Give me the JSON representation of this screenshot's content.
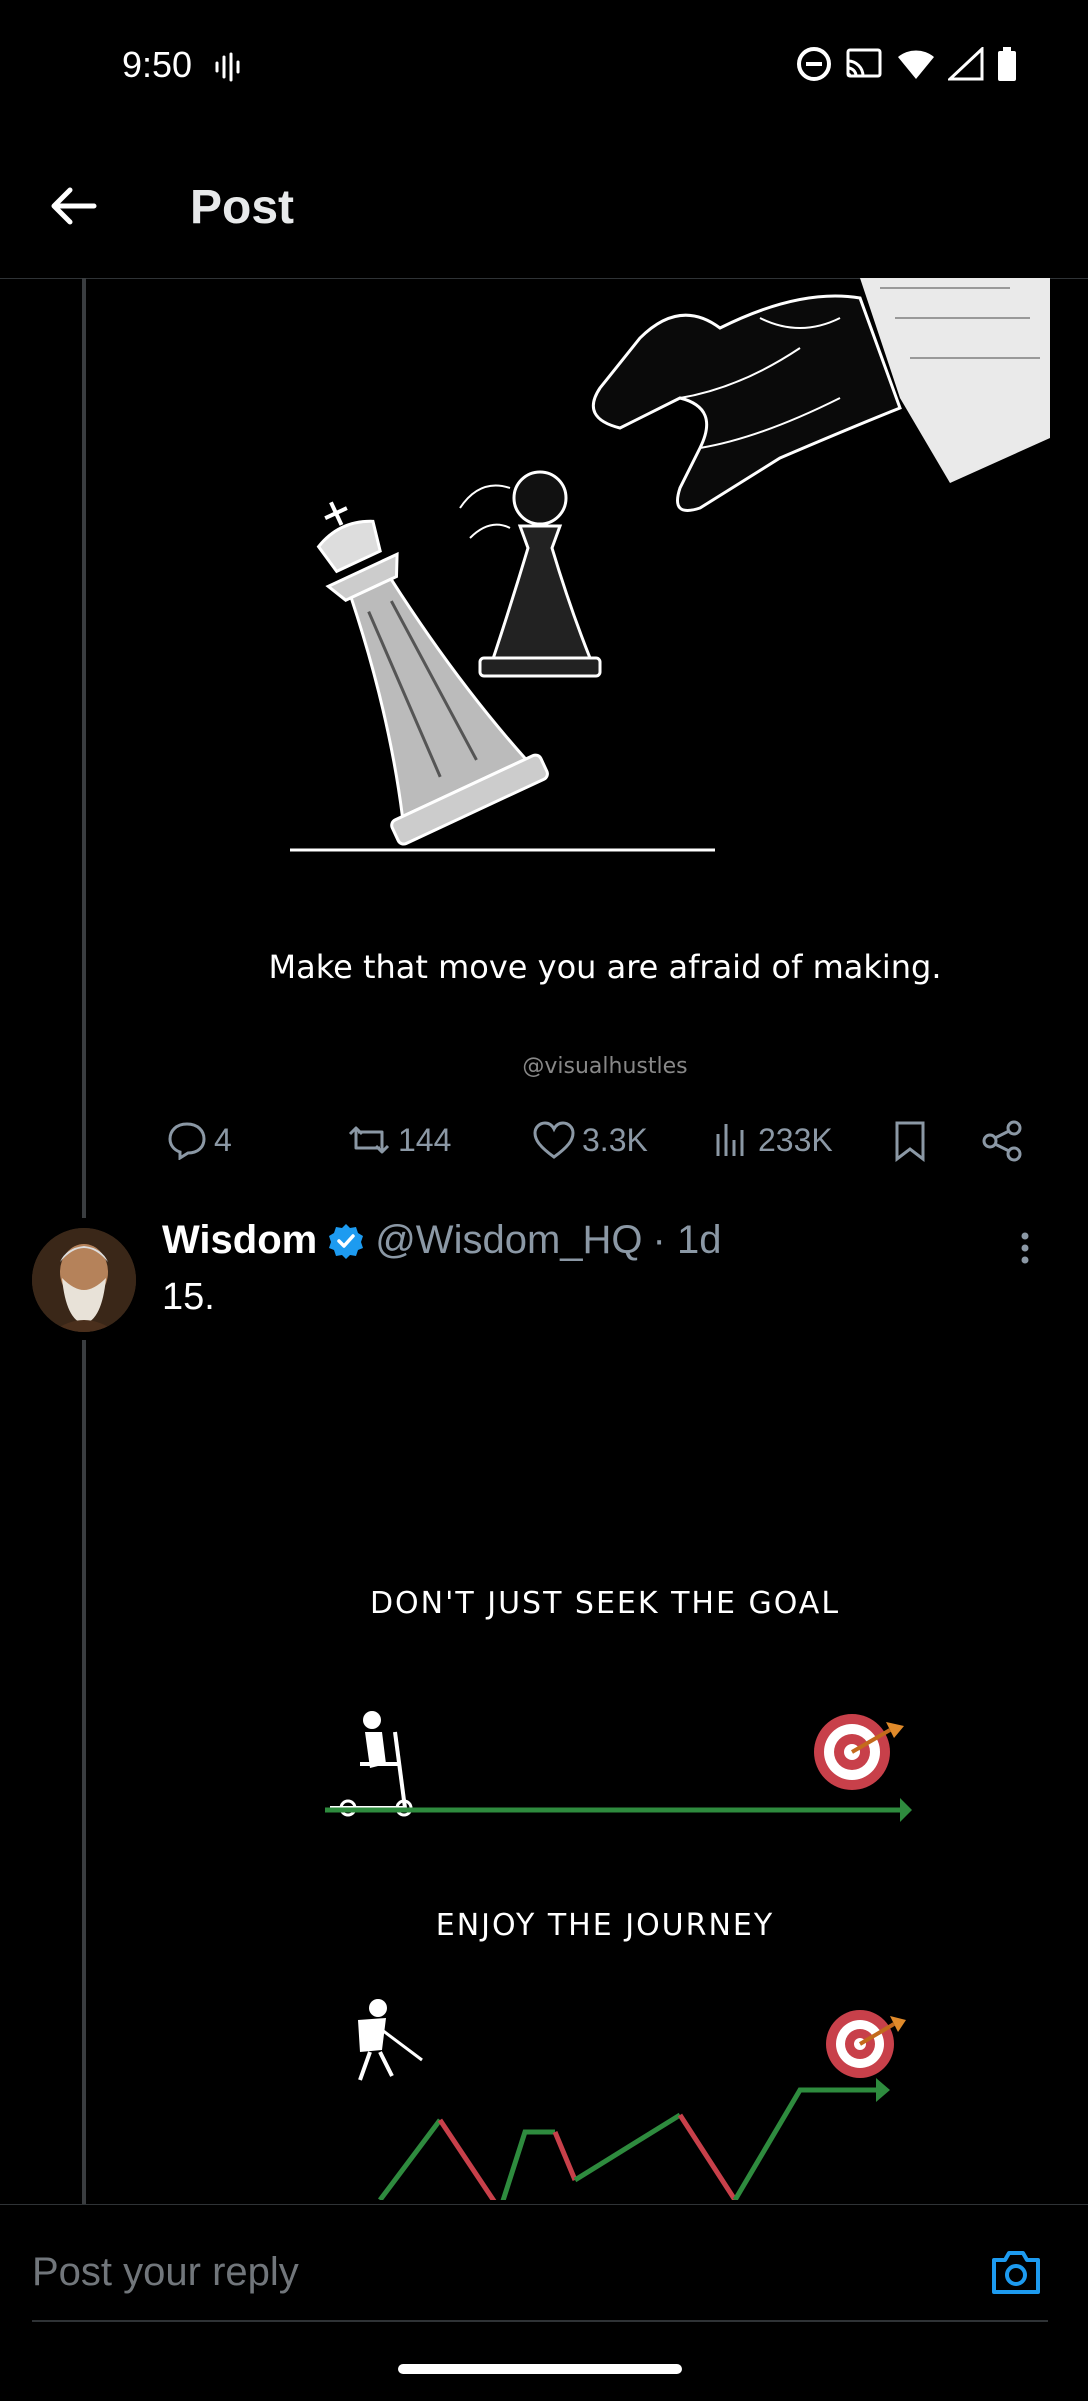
{
  "status_bar": {
    "time": "9:50"
  },
  "header": {
    "title": "Post"
  },
  "post1": {
    "image_caption": "Make that move you are afraid of making.",
    "image_credit": "@visualhustles",
    "replies": "4",
    "reposts": "144",
    "likes": "3.3K",
    "views": "233K"
  },
  "post2": {
    "name": "Wisdom",
    "handle": "@Wisdom_HQ",
    "time": "· 1d",
    "text": "15.",
    "image_line1": "DON'T JUST SEEK THE GOAL",
    "image_line2": "ENJOY THE JOURNEY"
  },
  "reply": {
    "placeholder": "Post your reply"
  },
  "colors": {
    "accent": "#1d9bf0",
    "green": "#2e8b3e",
    "red": "#c8404a"
  }
}
